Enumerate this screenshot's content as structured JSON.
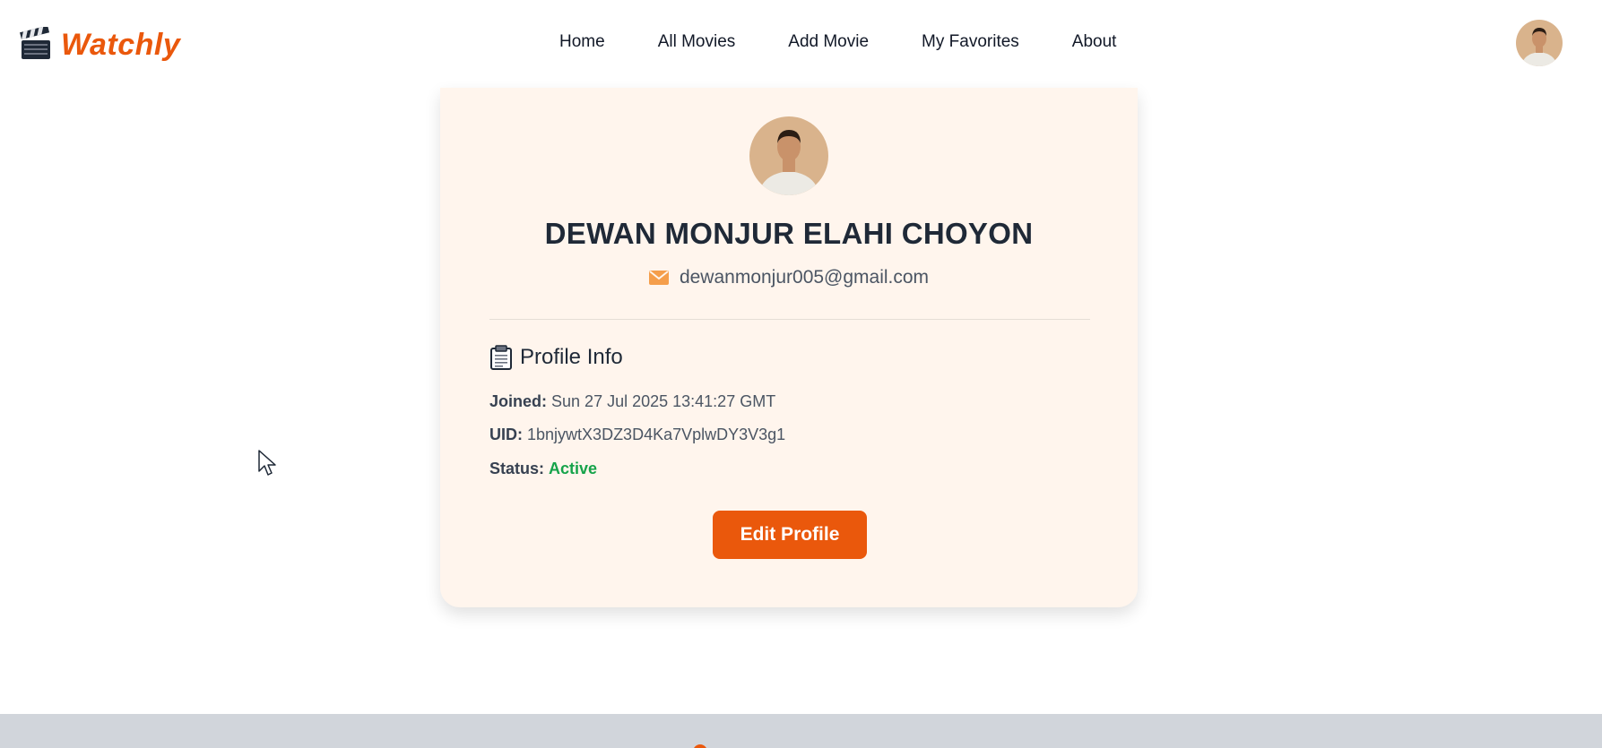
{
  "brand": {
    "name": "Watchly",
    "icon": "clapperboard-icon",
    "accent": "#ea580c"
  },
  "nav": {
    "links": [
      {
        "label": "Home"
      },
      {
        "label": "All Movies"
      },
      {
        "label": "Add Movie"
      },
      {
        "label": "My Favorites"
      },
      {
        "label": "About"
      }
    ]
  },
  "profile": {
    "name": "DEWAN MONJUR ELAHI CHOYON",
    "email_icon": "envelope-icon",
    "email": "dewanmonjur005@gmail.com",
    "section_title": "Profile Info",
    "section_icon": "clipboard-icon",
    "joined_label": "Joined:",
    "joined_value": "Sun 27 Jul 2025 13:41:27 GMT",
    "uid_label": "UID:",
    "uid_value": "1bnjywtX3DZ3D4Ka7VplwDY3V3g1",
    "status_label": "Status:",
    "status_value": "Active",
    "status_color": "#16a34a",
    "edit_button": "Edit Profile"
  },
  "colors": {
    "card_bg": "#fff5ed",
    "footer_bg": "#d1d5db"
  }
}
